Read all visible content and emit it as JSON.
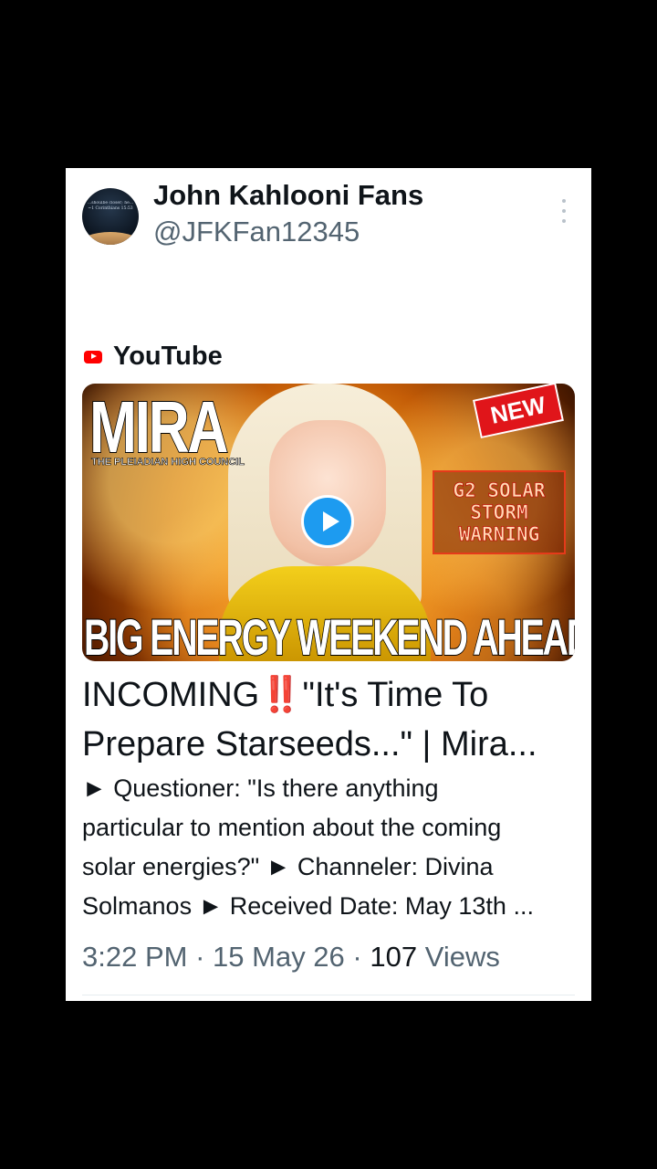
{
  "author": {
    "display_name": "John Kahlooni Fans",
    "handle": "@JFKFan12345",
    "avatar_text": [
      "...shoulbe closer; he...",
      "~1 Corinthians 15:53"
    ]
  },
  "source": {
    "label": "YouTube",
    "icon": "youtube-icon"
  },
  "thumbnail": {
    "title": "MIRA",
    "subtitle": "THE PLEIADIAN HIGH COUNCIL",
    "badge": "NEW",
    "warning_lines": [
      "G2 SOLAR",
      "STORM",
      "WARNING"
    ],
    "banner": "BIG ENERGY WEEKEND AHEAD",
    "play_icon": "play-icon"
  },
  "title_lines": [
    "INCOMING‼️\"It's Time To",
    "Prepare Starseeds...\" | Mira..."
  ],
  "description_lines": [
    "► Questioner: \"Is there anything",
    "particular to mention about the coming",
    "solar energies?\" ► Channeler: Divina",
    "Solmanos ► Received Date: May 13th ..."
  ],
  "meta": {
    "time": "3:22 PM",
    "separator": "·",
    "date": "15 May 26",
    "views_count": "107",
    "views_label": "Views"
  },
  "colors": {
    "accent": "#1d9bf0",
    "text": "#0f1419",
    "muted": "#536471",
    "youtube": "#ff0000"
  }
}
